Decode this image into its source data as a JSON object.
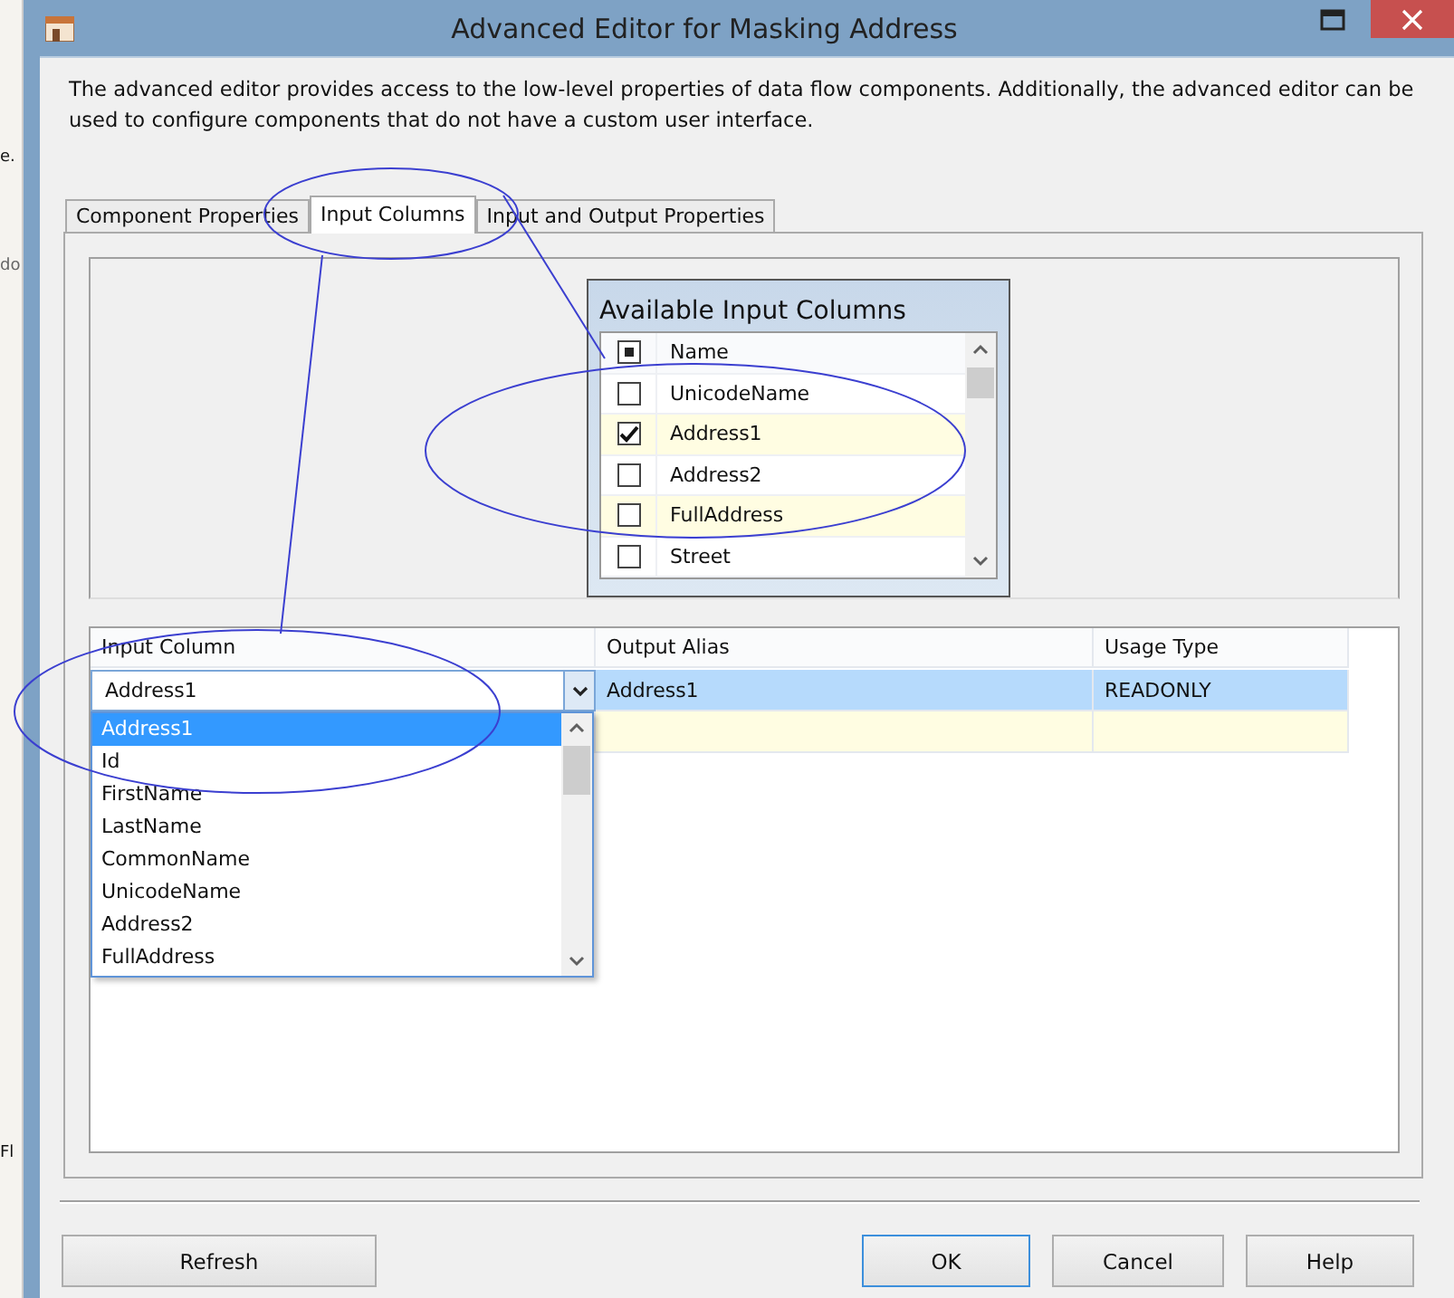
{
  "background_window": {
    "texts": [
      "e.",
      "do",
      "Fl"
    ]
  },
  "window": {
    "title": "Advanced Editor for Masking Address"
  },
  "description": "The advanced editor provides access to the low-level properties of data flow components. Additionally, the advanced editor can be used to configure components that do not have a custom user interface.",
  "tabs": [
    {
      "label": "Component Properties",
      "selected": false
    },
    {
      "label": "Input Columns",
      "selected": true
    },
    {
      "label": "Input and Output Properties",
      "selected": false
    }
  ],
  "available_columns": {
    "title": "Available Input Columns",
    "header": {
      "label": "Name",
      "indeterminate": true
    },
    "items": [
      {
        "name": "UnicodeName",
        "checked": false,
        "highlighted": false
      },
      {
        "name": "Address1",
        "checked": true,
        "highlighted": true
      },
      {
        "name": "Address2",
        "checked": false,
        "highlighted": false
      },
      {
        "name": "FullAddress",
        "checked": false,
        "highlighted": true
      },
      {
        "name": "Street",
        "checked": false,
        "highlighted": false
      }
    ]
  },
  "grid": {
    "columns": [
      "Input Column",
      "Output Alias",
      "Usage Type"
    ],
    "rows": [
      {
        "input_column": "Address1",
        "output_alias": "Address1",
        "usage_type": "READONLY",
        "selected": true
      }
    ],
    "new_row": true,
    "dropdown": {
      "expanded": true,
      "items": [
        {
          "label": "Address1",
          "selected": true
        },
        {
          "label": "Id",
          "selected": false
        },
        {
          "label": "FirstName",
          "selected": false
        },
        {
          "label": "LastName",
          "selected": false
        },
        {
          "label": "CommonName",
          "selected": false
        },
        {
          "label": "UnicodeName",
          "selected": false
        },
        {
          "label": "Address2",
          "selected": false
        },
        {
          "label": "FullAddress",
          "selected": false
        }
      ]
    }
  },
  "buttons": [
    {
      "label": "Refresh",
      "default": false
    },
    {
      "label": "OK",
      "default": true
    },
    {
      "label": "Cancel",
      "default": false
    },
    {
      "label": "Help",
      "default": false
    }
  ]
}
